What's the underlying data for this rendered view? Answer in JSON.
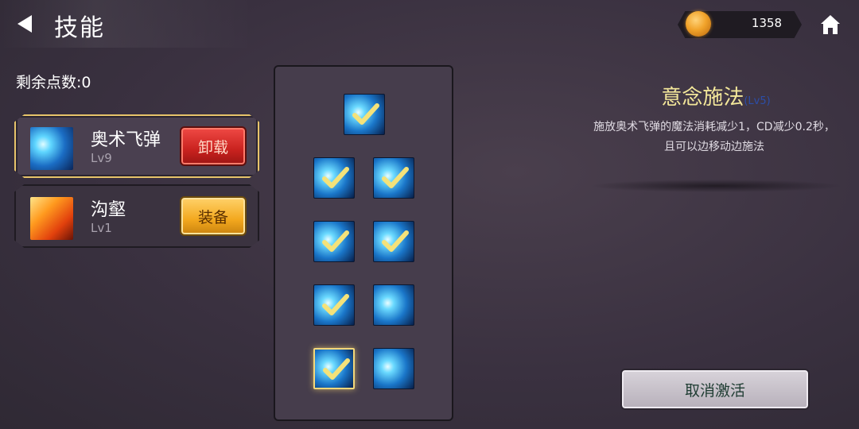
{
  "header": {
    "title": "技能",
    "coins": "1358"
  },
  "points": {
    "label": "剩余点数:0"
  },
  "skills": [
    {
      "name": "奥术飞弹",
      "level": "Lv9",
      "button_label": "卸载",
      "icon": "arcane-missile-icon",
      "selected": true
    },
    {
      "name": "沟壑",
      "level": "Lv1",
      "button_label": "装备",
      "icon": "ravine-fire-icon",
      "selected": false
    }
  ],
  "tree": {
    "nodes": [
      {
        "checked": true,
        "active": false
      },
      {
        "checked": true,
        "active": false
      },
      {
        "checked": true,
        "active": false
      },
      {
        "checked": true,
        "active": false
      },
      {
        "checked": true,
        "active": false
      },
      {
        "checked": true,
        "active": false
      },
      {
        "checked": false,
        "active": false
      },
      {
        "checked": true,
        "active": true
      },
      {
        "checked": false,
        "active": false
      }
    ]
  },
  "detail": {
    "name": "意念施法",
    "level": "(Lv5)",
    "description_line1": "施放奥术飞弹的魔法消耗减少1，CD减少0.2秒，",
    "description_line2": "且可以边移动边施法"
  },
  "actions": {
    "cancel_label": "取消激活"
  },
  "colors": {
    "background": "#3a3140",
    "highlight_gold": "#e7c46a",
    "title_yellow": "#f3e79a",
    "level_blue": "#2c4ea8",
    "uninstall_red": "#c9221f",
    "equip_orange": "#f3a81e"
  }
}
